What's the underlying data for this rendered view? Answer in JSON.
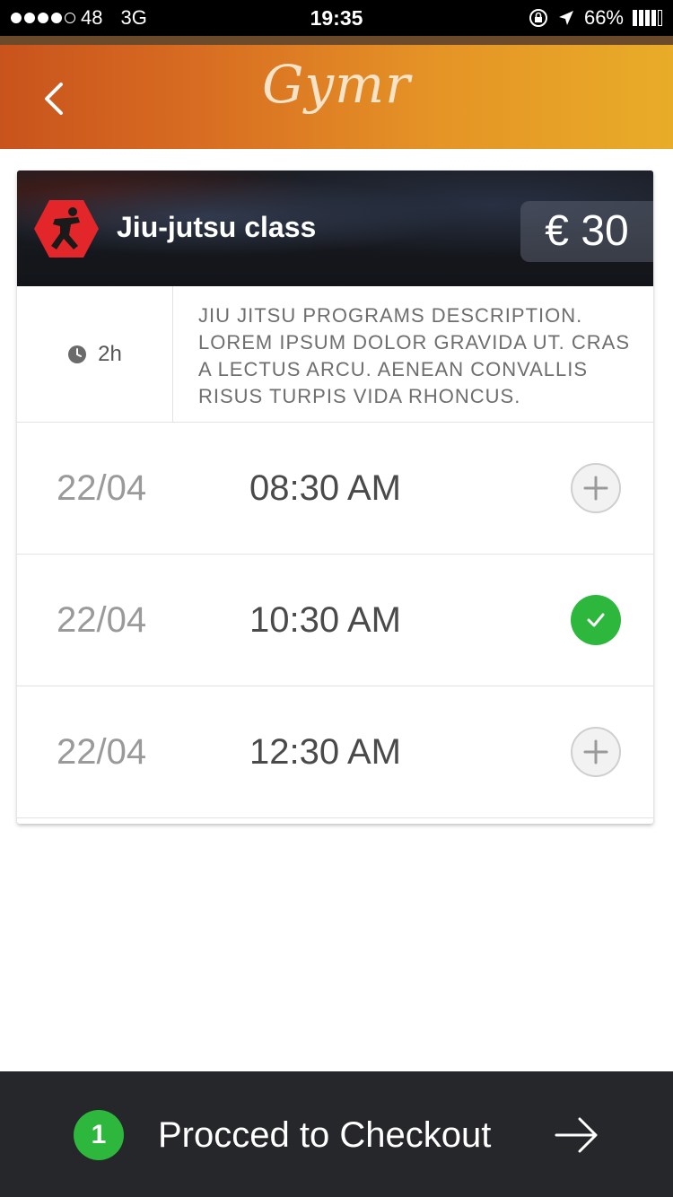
{
  "status_bar": {
    "carrier": "48",
    "network": "3G",
    "time": "19:35",
    "battery": "66%",
    "icons": [
      "lock-rotation-icon",
      "location-arrow-icon",
      "battery-icon"
    ]
  },
  "nav": {
    "logo": "Gymr",
    "back_icon": "chevron-left-icon"
  },
  "class": {
    "title": "Jiu-jutsu class",
    "price": "€ 30",
    "icon": "martial-arts-icon",
    "icon_color": "#e2262a",
    "duration": "2h",
    "description": "Jiu jitsu programs description. Lorem ipsum dolor gravida ut. Cras a lectus arcu. Aenean convallis risus turpis vida rhoncus."
  },
  "slots": [
    {
      "date": "22/04",
      "time": "08:30 AM",
      "selected": false
    },
    {
      "date": "22/04",
      "time": "10:30 AM",
      "selected": true
    },
    {
      "date": "22/04",
      "time": "12:30 AM",
      "selected": false
    }
  ],
  "checkout": {
    "count": "1",
    "label": "Procced to Checkout"
  },
  "colors": {
    "accent_green": "#2db83d",
    "header_start": "#c9531c",
    "header_end": "#e8ac28",
    "bottom_bar": "#26272b"
  }
}
